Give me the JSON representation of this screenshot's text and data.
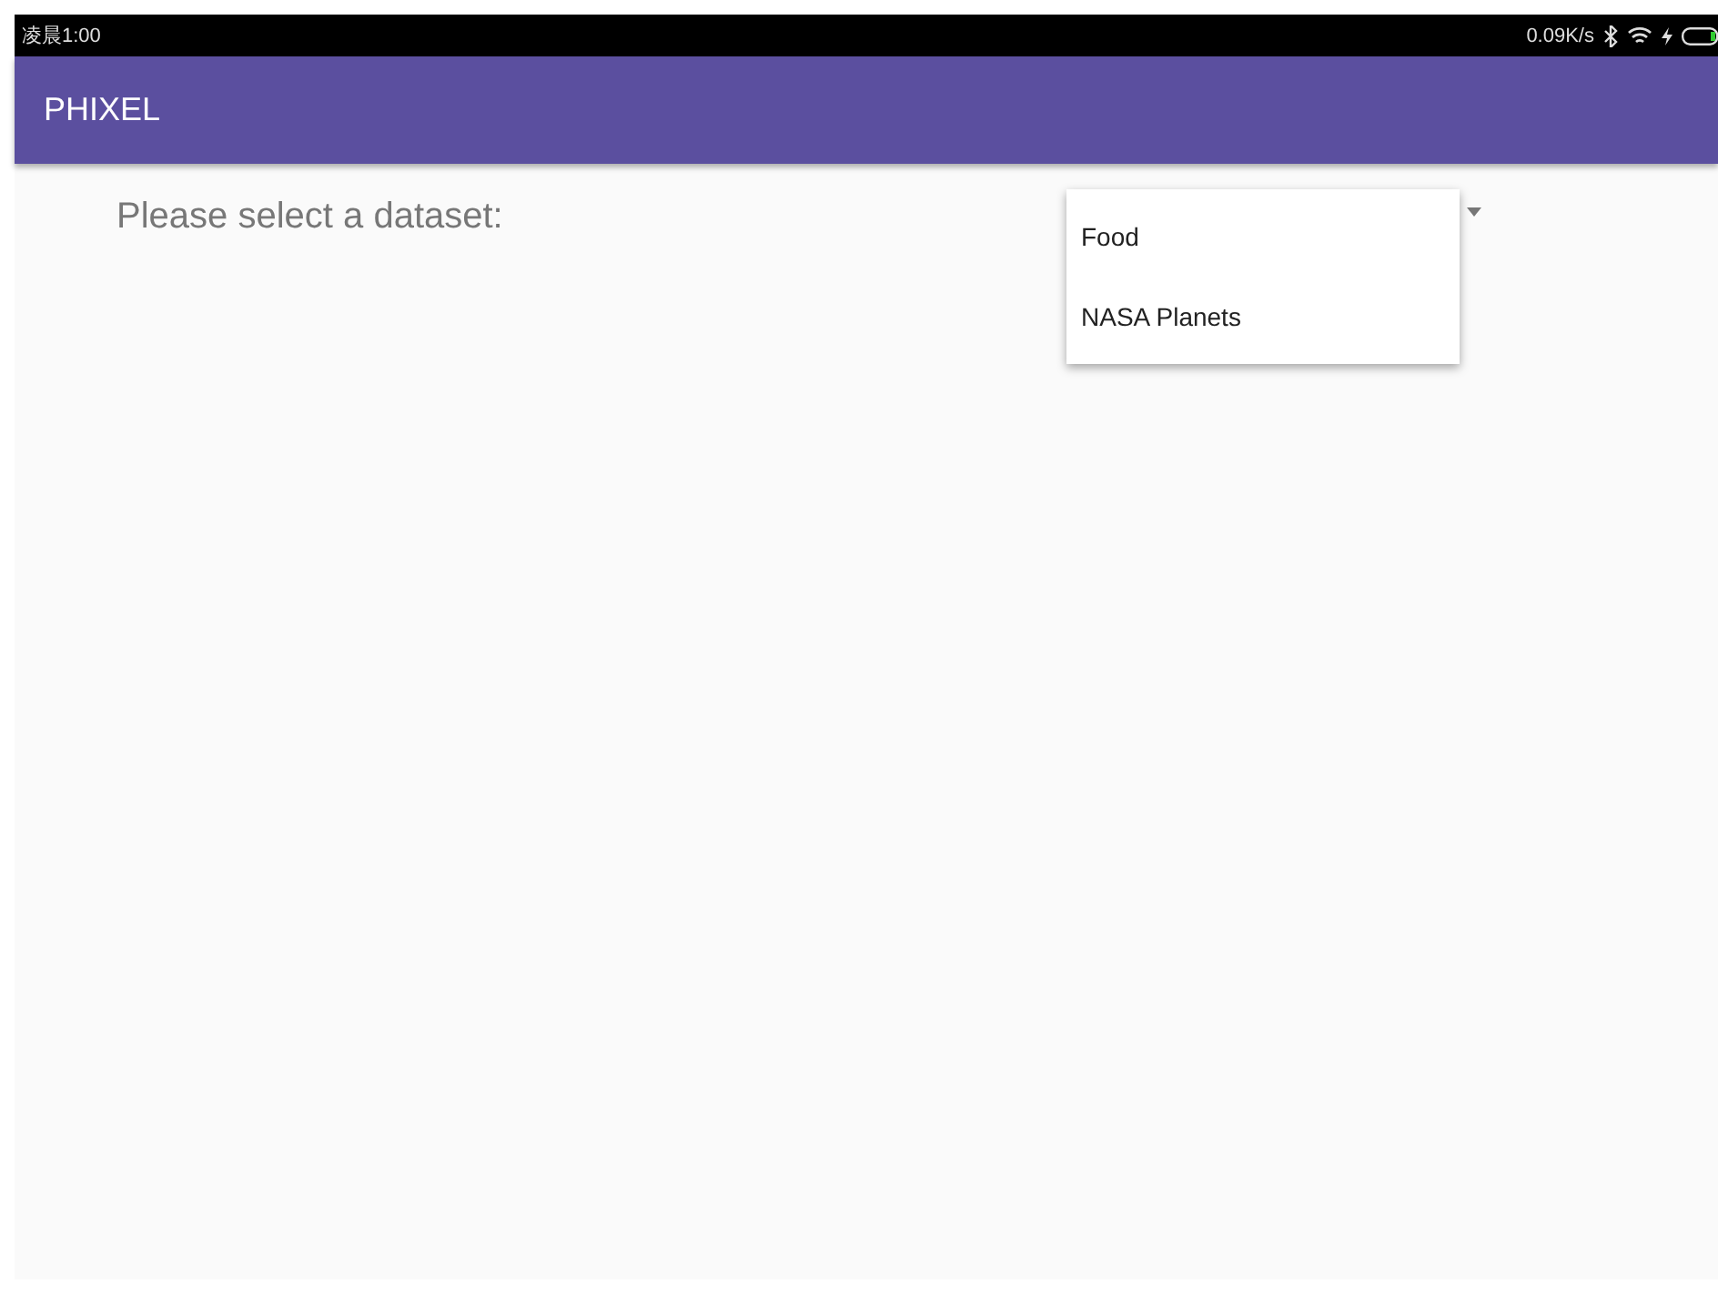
{
  "status_bar": {
    "time": "凌晨1:00",
    "speed": "0.09K/s"
  },
  "app_bar": {
    "title": "PHIXEL"
  },
  "prompt": "Please select a dataset:",
  "dropdown": {
    "expanded": true,
    "options": [
      {
        "label": "Food"
      },
      {
        "label": "NASA Planets"
      }
    ]
  }
}
